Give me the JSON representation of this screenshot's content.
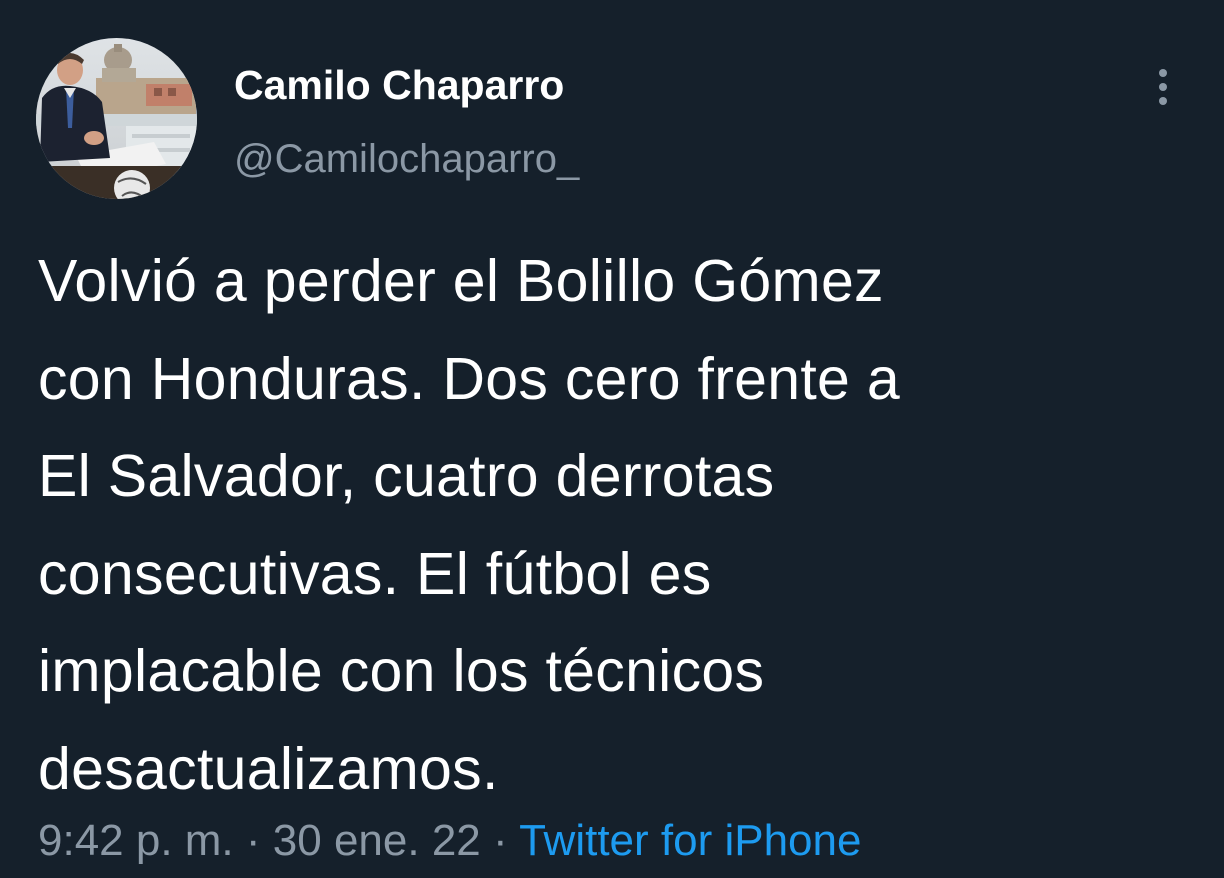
{
  "author": {
    "display_name": "Camilo Chaparro",
    "handle": "@Camilochaparro_",
    "avatar_icon": "profile-photo"
  },
  "menu": {
    "icon": "more-vertical-icon"
  },
  "tweet": {
    "text": "Volvió a perder el Bolillo Gómez\ncon Honduras. Dos cero frente a\nEl Salvador, cuatro derrotas\nconsecutivas. El fútbol es\nimplacable con los técnicos\ndesactualizamos."
  },
  "meta": {
    "time": "9:42 p. m.",
    "separator": "·",
    "date": "30 ene. 22",
    "source": "Twitter for iPhone"
  },
  "colors": {
    "background": "#15202b",
    "primary_text": "#ffffff",
    "secondary_text": "#8b98a5",
    "link": "#1d9bf0"
  }
}
